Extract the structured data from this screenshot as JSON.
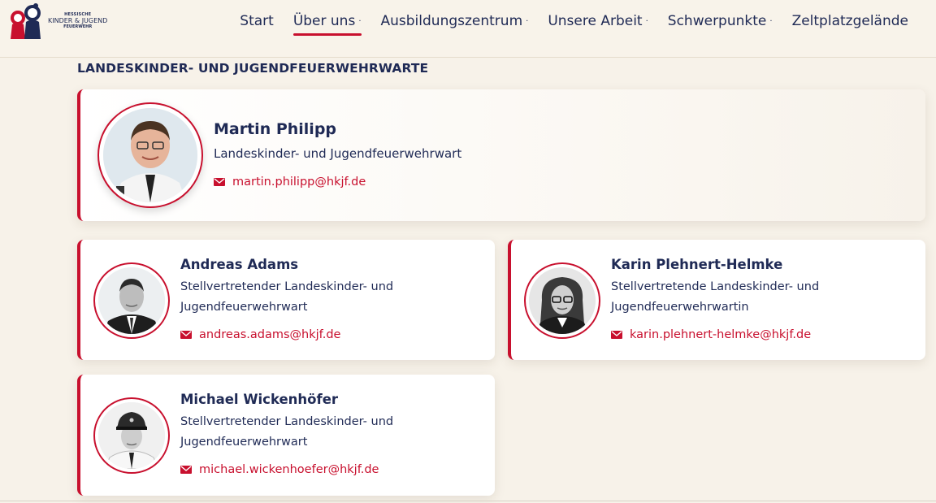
{
  "header": {
    "logo": {
      "line1": "HESSISCHE",
      "line2": "KINDER & JUGEND",
      "line3": "FEUERWEHR"
    },
    "nav": [
      {
        "label": "Start",
        "caret": ""
      },
      {
        "label": "Über uns",
        "caret": "·",
        "active": true
      },
      {
        "label": "Ausbildungszentrum",
        "caret": "·"
      },
      {
        "label": "Unsere Arbeit",
        "caret": "·"
      },
      {
        "label": "Schwerpunkte",
        "caret": "·"
      },
      {
        "label": "Zeltplatzgelände",
        "caret": ""
      }
    ]
  },
  "section": {
    "title": "LANDESKINDER- UND JUGENDFEUERWEHRWARTE"
  },
  "people": [
    {
      "name": "Martin Philipp",
      "role_line1": "Landeskinder- und Jugendfeuerwehrwart",
      "role_line2": "",
      "email": "martin.philipp@hkjf.de"
    },
    {
      "name": "Andreas Adams",
      "role_line1": "Stellvertretender Landeskinder- und",
      "role_line2": "Jugendfeuerwehrwart",
      "email": "andreas.adams@hkjf.de"
    },
    {
      "name": "Karin Plehnert-Helmke",
      "role_line1": "Stellvertretende Landeskinder- und",
      "role_line2": "Jugendfeuerwehrwartin",
      "email": "karin.plehnert-helmke@hkjf.de"
    },
    {
      "name": "Michael Wickenhöfer",
      "role_line1": "Stellvertretender Landeskinder- und",
      "role_line2": "Jugendfeuerwehrwart",
      "email": "michael.wickenhoefer@hkjf.de"
    }
  ],
  "colors": {
    "accent": "#c8102e",
    "navy": "#1f2a55",
    "background": "#f7f2e9"
  },
  "icons": {
    "email": "mail-icon"
  }
}
